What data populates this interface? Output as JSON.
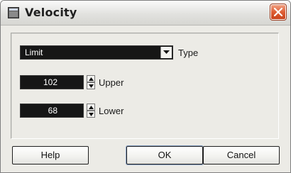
{
  "window": {
    "title": "Velocity"
  },
  "type_field": {
    "value": "Limit",
    "label": "Type"
  },
  "upper_field": {
    "value": "102",
    "label": "Upper"
  },
  "lower_field": {
    "value": "68",
    "label": "Lower"
  },
  "buttons": {
    "help": "Help",
    "ok": "OK",
    "cancel": "Cancel"
  },
  "icons": {
    "app": "app-window-icon",
    "close": "close-x-icon",
    "dropdown": "chevron-down-icon",
    "spin_up": "spin-up-arrow-icon",
    "spin_down": "spin-down-arrow-icon"
  },
  "colors": {
    "close_button": "#de5d34",
    "field_background": "#161616",
    "dialog_background": "#ecebe6"
  }
}
